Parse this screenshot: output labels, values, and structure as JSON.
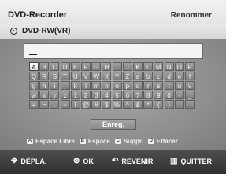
{
  "header": {
    "title": "DVD-Recorder",
    "action": "Renommer"
  },
  "disc": {
    "label": "DVD-RW(VR)",
    "icon": "disc-icon"
  },
  "input": {
    "value": ""
  },
  "keyboard": {
    "selected_index": 0,
    "rows": [
      [
        "A",
        "B",
        "C",
        "D",
        "E",
        "F",
        "G",
        "H",
        "I",
        "J",
        "K",
        "L",
        "M",
        "N",
        "O",
        "P"
      ],
      [
        "Q",
        "R",
        "S",
        "T",
        "U",
        "V",
        "W",
        "X",
        "Y",
        "Z",
        "a",
        "b",
        "c",
        "d",
        "e",
        "f"
      ],
      [
        "g",
        "h",
        "i",
        "j",
        "k",
        "l",
        "m",
        "n",
        "o",
        "p",
        "q",
        "r",
        "s",
        "t",
        "u",
        "v"
      ],
      [
        "w",
        "x",
        "y",
        "z",
        "1",
        "2",
        "3",
        "4",
        "5",
        "6",
        "7",
        "8",
        "9",
        "0",
        "-",
        "_"
      ],
      [
        "+",
        "=",
        ".",
        "~",
        "!",
        "@",
        "#",
        "$",
        "%",
        "^",
        "&",
        "*",
        "(",
        ")",
        "",
        ""
      ]
    ]
  },
  "enreg_label": "Enreg.",
  "legend": [
    {
      "icon": "red-square-icon",
      "label": "Espace Libre"
    },
    {
      "icon": "green-square-icon",
      "label": "Espace"
    },
    {
      "icon": "yellow-square-icon",
      "label": "Suppr."
    },
    {
      "icon": "blue-square-icon",
      "label": "Effacer"
    }
  ],
  "footer": {
    "move": "DÉPLA.",
    "ok": "OK",
    "back": "REVENIR",
    "quit": "QUITTER"
  },
  "colors": {
    "background": "#c9c9c9",
    "panel": "#8f8f8f",
    "footer": "#3a3a3a"
  }
}
